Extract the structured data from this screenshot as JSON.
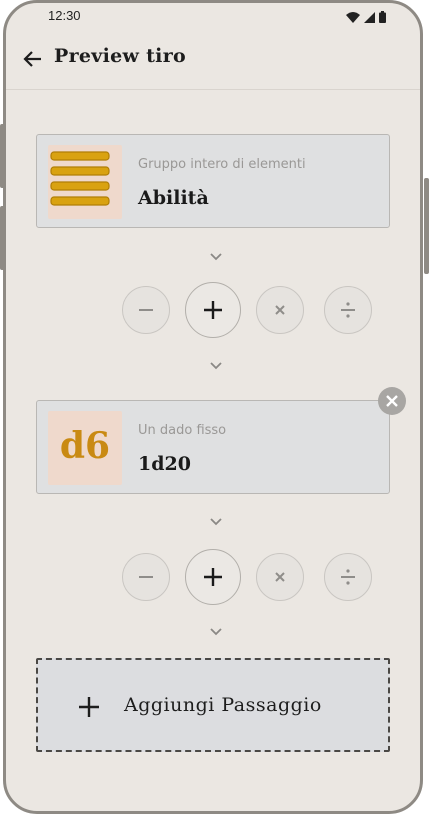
{
  "status_bar": {
    "time": "12:30",
    "icons": [
      "wifi-icon",
      "signal-icon",
      "battery-icon"
    ]
  },
  "app_bar": {
    "back_icon": "arrow-left-icon",
    "title": "Preview tiro"
  },
  "steps": [
    {
      "caption": "Gruppo intero di elementi",
      "value": "Abilità",
      "thumbnail_icon": "list-lines-icon"
    },
    {
      "caption": "Un dado fisso",
      "value": "1d20",
      "thumbnail_text": "d6",
      "removable": true
    }
  ],
  "operators": [
    {
      "name": "minus",
      "icon": "minus-icon",
      "selected": false
    },
    {
      "name": "plus",
      "icon": "plus-icon",
      "selected": true
    },
    {
      "name": "multiply",
      "icon": "multiply-icon",
      "selected": false
    },
    {
      "name": "divide",
      "icon": "divide-icon",
      "selected": false
    }
  ],
  "add_step": {
    "label": "Aggiungi Passaggio",
    "icon": "plus-icon"
  },
  "colors": {
    "background": "#ebe7e2",
    "card": "#dfe0e1",
    "accent_gold": "#d9a211",
    "thumb_bg": "#efd9cc"
  }
}
